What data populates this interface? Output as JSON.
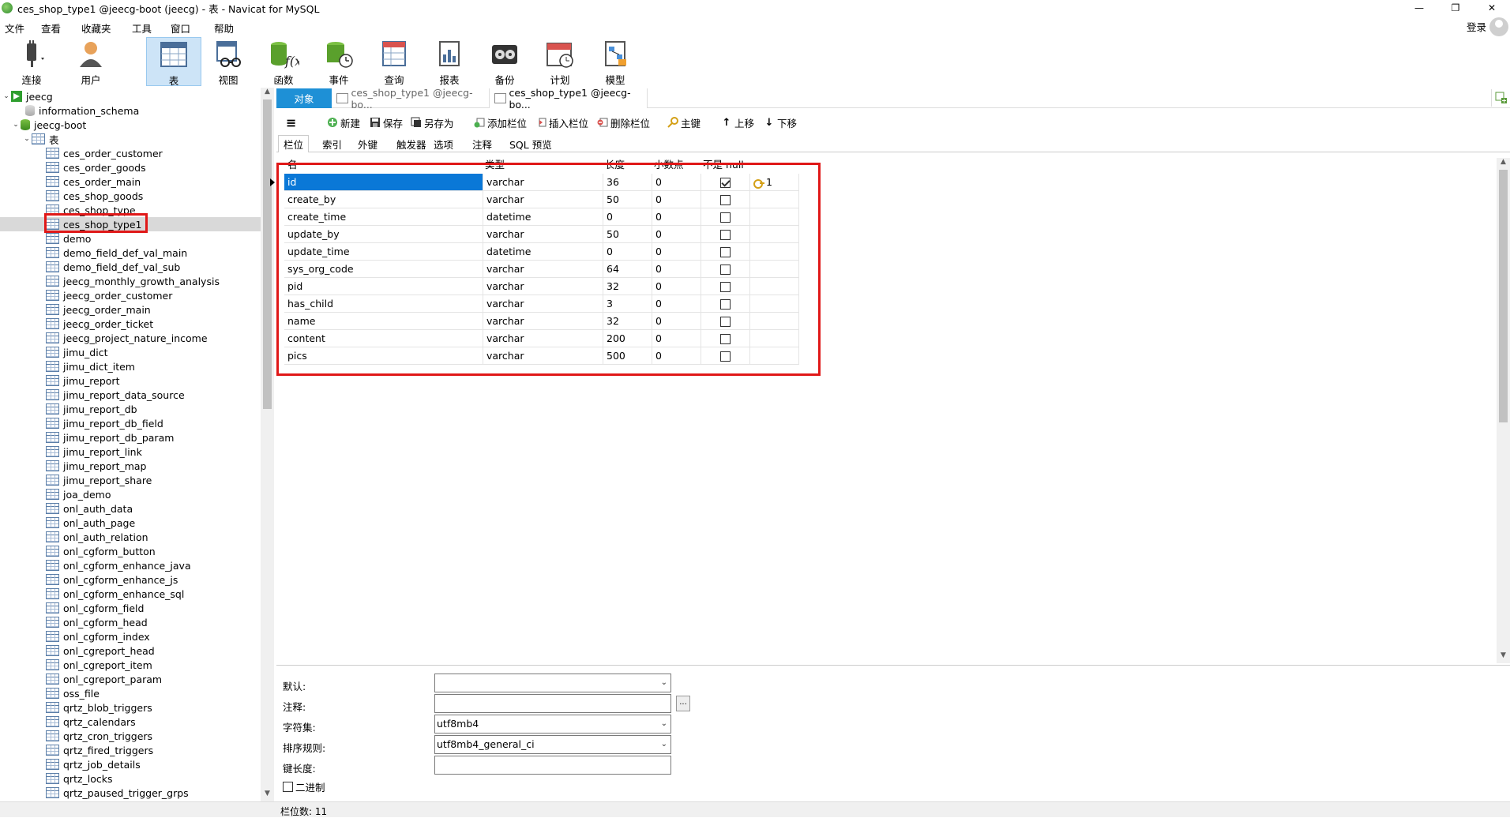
{
  "window": {
    "title": "ces_shop_type1 @jeecg-boot (jeecg) - 表 - Navicat for MySQL",
    "minimize": "—",
    "restore": "❐",
    "close": "✕"
  },
  "menu": {
    "items": [
      "文件",
      "查看",
      "收藏夹",
      "工具",
      "窗口",
      "帮助"
    ],
    "login": "登录"
  },
  "toolbar": {
    "buttons": [
      {
        "label": "连接",
        "icon": "plug-icon"
      },
      {
        "label": "用户",
        "icon": "user-icon"
      },
      {
        "label": "表",
        "icon": "table-icon",
        "active": true
      },
      {
        "label": "视图",
        "icon": "view-icon"
      },
      {
        "label": "函数",
        "icon": "function-icon"
      },
      {
        "label": "事件",
        "icon": "event-icon"
      },
      {
        "label": "查询",
        "icon": "query-icon"
      },
      {
        "label": "报表",
        "icon": "report-icon"
      },
      {
        "label": "备份",
        "icon": "backup-icon"
      },
      {
        "label": "计划",
        "icon": "schedule-icon"
      },
      {
        "label": "模型",
        "icon": "model-icon"
      }
    ]
  },
  "tree": {
    "connection": "jeecg",
    "databases": [
      "information_schema",
      "jeecg-boot"
    ],
    "tables_node": "表",
    "tables": [
      "ces_order_customer",
      "ces_order_goods",
      "ces_order_main",
      "ces_shop_goods",
      "ces_shop_type",
      "ces_shop_type1",
      "demo",
      "demo_field_def_val_main",
      "demo_field_def_val_sub",
      "jeecg_monthly_growth_analysis",
      "jeecg_order_customer",
      "jeecg_order_main",
      "jeecg_order_ticket",
      "jeecg_project_nature_income",
      "jimu_dict",
      "jimu_dict_item",
      "jimu_report",
      "jimu_report_data_source",
      "jimu_report_db",
      "jimu_report_db_field",
      "jimu_report_db_param",
      "jimu_report_link",
      "jimu_report_map",
      "jimu_report_share",
      "joa_demo",
      "onl_auth_data",
      "onl_auth_page",
      "onl_auth_relation",
      "onl_cgform_button",
      "onl_cgform_enhance_java",
      "onl_cgform_enhance_js",
      "onl_cgform_enhance_sql",
      "onl_cgform_field",
      "onl_cgform_head",
      "onl_cgform_index",
      "onl_cgreport_head",
      "onl_cgreport_item",
      "onl_cgreport_param",
      "oss_file",
      "qrtz_blob_triggers",
      "qrtz_calendars",
      "qrtz_cron_triggers",
      "qrtz_fired_triggers",
      "qrtz_job_details",
      "qrtz_locks",
      "qrtz_paused_trigger_grps"
    ],
    "selected": "ces_shop_type1"
  },
  "tabs": {
    "objects": "对象",
    "tab1": "ces_shop_type1 @jeecg-bo...",
    "tab2": "ces_shop_type1 @jeecg-bo..."
  },
  "actions": {
    "new": "新建",
    "save": "保存",
    "save_as": "另存为",
    "add_field": "添加栏位",
    "insert_field": "插入栏位",
    "delete_field": "删除栏位",
    "primary_key": "主键",
    "move_up": "上移",
    "move_down": "下移"
  },
  "subtabs": [
    "栏位",
    "索引",
    "外键",
    "触发器",
    "选项",
    "注释",
    "SQL 预览"
  ],
  "grid": {
    "headers": [
      "名",
      "类型",
      "长度",
      "小数点",
      "不是 null",
      ""
    ],
    "rows": [
      {
        "name": "id",
        "type": "varchar",
        "length": "36",
        "decimals": "0",
        "not_null": true,
        "key": "1"
      },
      {
        "name": "create_by",
        "type": "varchar",
        "length": "50",
        "decimals": "0",
        "not_null": false,
        "key": ""
      },
      {
        "name": "create_time",
        "type": "datetime",
        "length": "0",
        "decimals": "0",
        "not_null": false,
        "key": ""
      },
      {
        "name": "update_by",
        "type": "varchar",
        "length": "50",
        "decimals": "0",
        "not_null": false,
        "key": ""
      },
      {
        "name": "update_time",
        "type": "datetime",
        "length": "0",
        "decimals": "0",
        "not_null": false,
        "key": ""
      },
      {
        "name": "sys_org_code",
        "type": "varchar",
        "length": "64",
        "decimals": "0",
        "not_null": false,
        "key": ""
      },
      {
        "name": "pid",
        "type": "varchar",
        "length": "32",
        "decimals": "0",
        "not_null": false,
        "key": ""
      },
      {
        "name": "has_child",
        "type": "varchar",
        "length": "3",
        "decimals": "0",
        "not_null": false,
        "key": ""
      },
      {
        "name": "name",
        "type": "varchar",
        "length": "32",
        "decimals": "0",
        "not_null": false,
        "key": ""
      },
      {
        "name": "content",
        "type": "varchar",
        "length": "200",
        "decimals": "0",
        "not_null": false,
        "key": ""
      },
      {
        "name": "pics",
        "type": "varchar",
        "length": "500",
        "decimals": "0",
        "not_null": false,
        "key": ""
      }
    ]
  },
  "props": {
    "default_label": "默认:",
    "default_value": "",
    "comment_label": "注释:",
    "comment_value": "",
    "comment_btn": "...",
    "charset_label": "字符集:",
    "charset_value": "utf8mb4",
    "collation_label": "排序规则:",
    "collation_value": "utf8mb4_general_ci",
    "keylen_label": "键长度:",
    "keylen_value": "",
    "binary_label": "二进制"
  },
  "status": {
    "field_count": "栏位数: 11"
  },
  "colors": {
    "accent": "#1e90d6",
    "selection": "#0a78d7",
    "highlight_box": "#e01818"
  }
}
